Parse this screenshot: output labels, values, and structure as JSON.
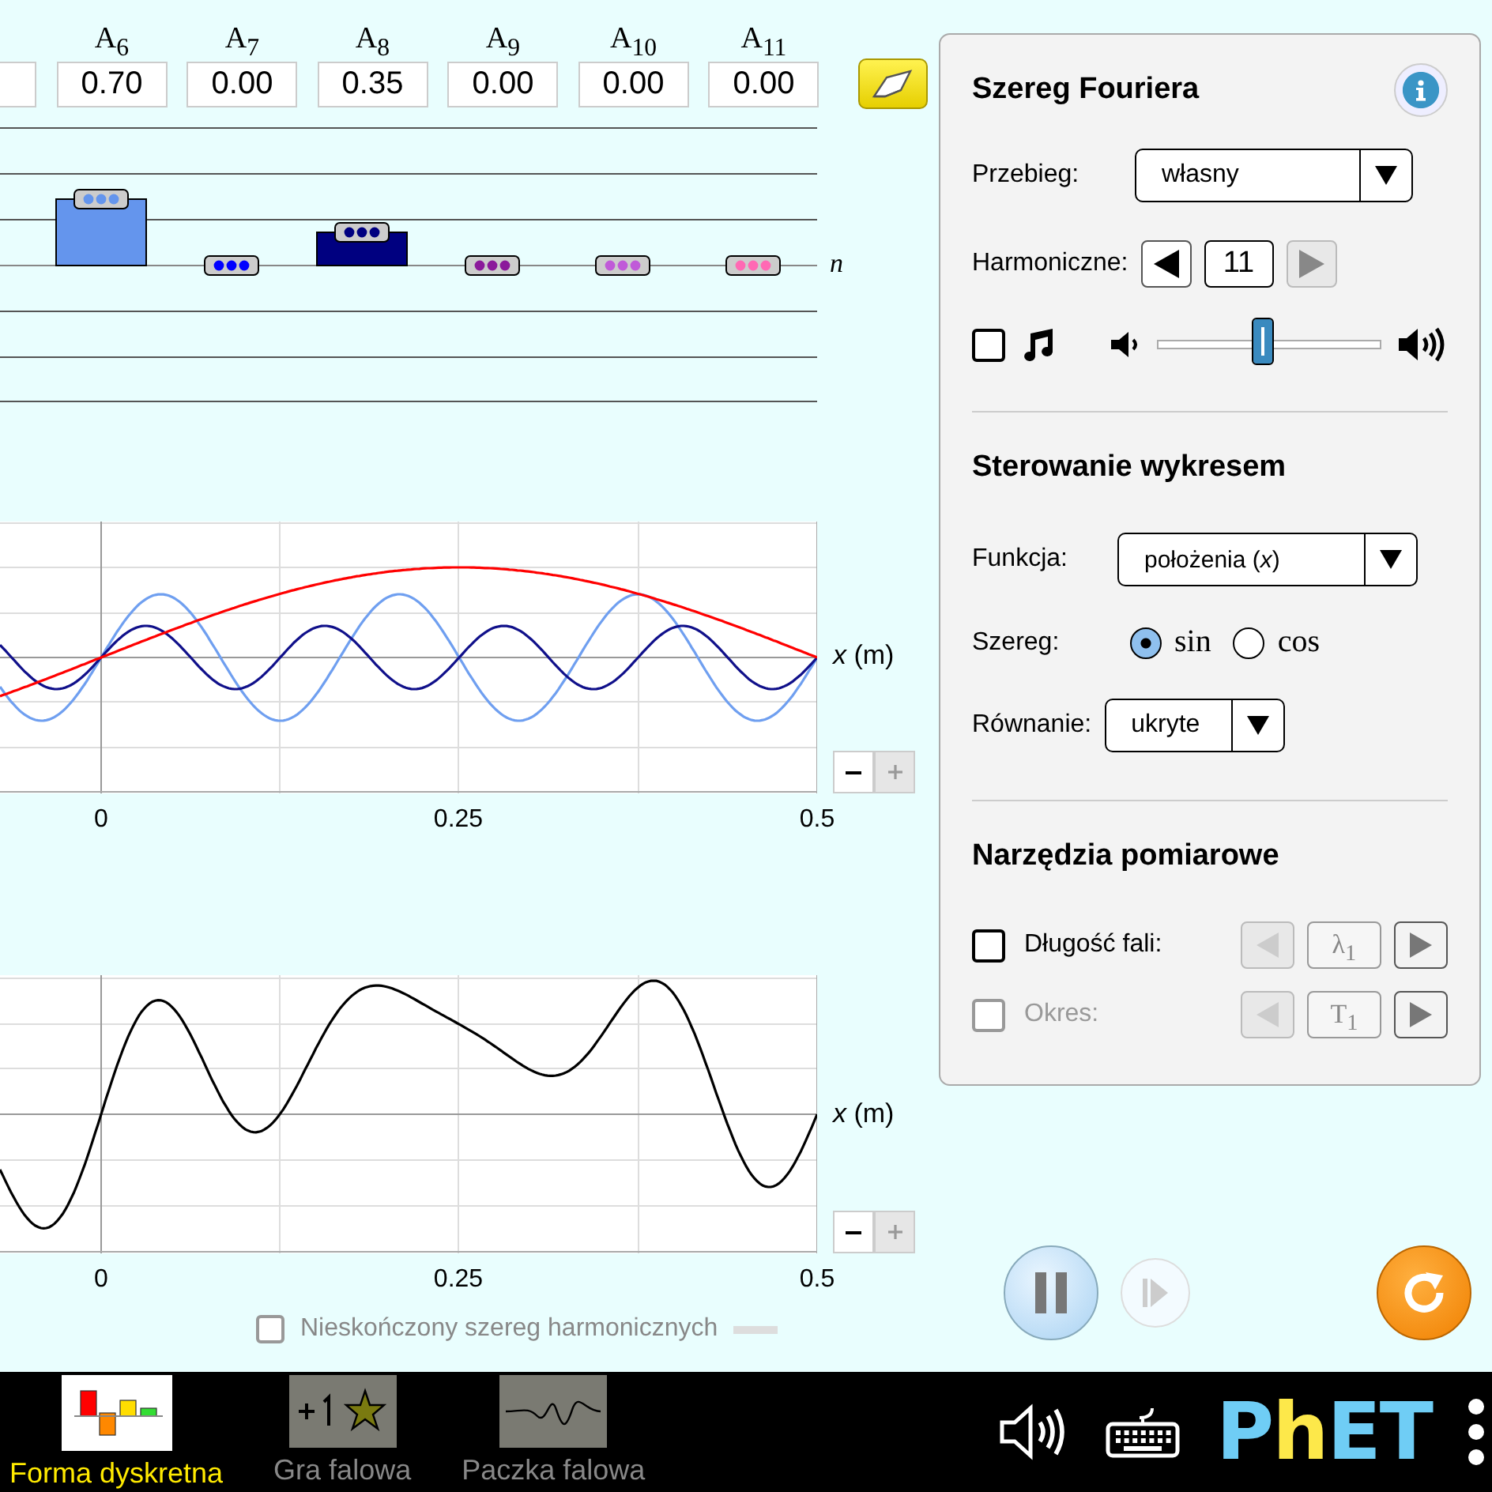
{
  "amplitudes": [
    {
      "label": "A$_{6}$",
      "value": "0.70",
      "color": "#6495ed"
    },
    {
      "label": "A$_{7}$",
      "value": "0.00",
      "color": "#0000ff"
    },
    {
      "label": "A$_{8}$",
      "value": "0.35",
      "color": "#000080"
    },
    {
      "label": "A$_{9}$",
      "value": "0.00",
      "color": "#8b1a9b"
    },
    {
      "label": "A$_{10}$",
      "value": "0.00",
      "color": "#c05ad8"
    },
    {
      "label": "A$_{11}$",
      "value": "0.00",
      "color": "#ff69b4"
    }
  ],
  "amplitude_axis_label": "n",
  "harmonics_chart": {
    "x_label": "*x* (m)",
    "ticks": [
      "0",
      "0.25",
      "0.5"
    ]
  },
  "sum_chart": {
    "x_label": "*x* (m)",
    "ticks": [
      "0",
      "0.25",
      "0.5"
    ]
  },
  "infinite_series": {
    "label": "Nieskończony szereg harmonicznych",
    "checked": false,
    "disabled": true
  },
  "panel": {
    "title": "Szereg Fouriera",
    "waveform": {
      "label": "Przebieg:",
      "value": "własny"
    },
    "harmonics": {
      "label": "Harmoniczne:",
      "value": "11",
      "decrease_disabled": false,
      "increase_disabled": true
    },
    "sound": {
      "checked": false
    },
    "volume": {
      "level": 0.47
    },
    "graph_title": "Sterowanie wykresem",
    "function": {
      "label": "Funkcja:",
      "value": "położenia (*x*)"
    },
    "series": {
      "label": "Szereg:",
      "options": [
        {
          "label": "sin",
          "selected": true
        },
        {
          "label": "cos",
          "selected": false
        }
      ]
    },
    "equation": {
      "label": "Równanie:",
      "value": "ukryte"
    },
    "tools_title": "Narzędzia pomiarowe",
    "tools": [
      {
        "label": "Długość fali:",
        "value": "λ$_{1}$",
        "checked": false,
        "disabled": false,
        "previous_disabled": true,
        "next_disabled": false
      },
      {
        "label": "Okres:",
        "value": "T$_{1}$",
        "checked": false,
        "disabled": true,
        "previous_disabled": true,
        "next_disabled": false
      }
    ]
  },
  "playing": true,
  "screens": [
    {
      "label": "Forma dyskretna",
      "selected": true
    },
    {
      "label": "Gra falowa",
      "selected": false
    },
    {
      "label": "Paczka falowa",
      "selected": false
    }
  ],
  "logo": "PhET"
}
